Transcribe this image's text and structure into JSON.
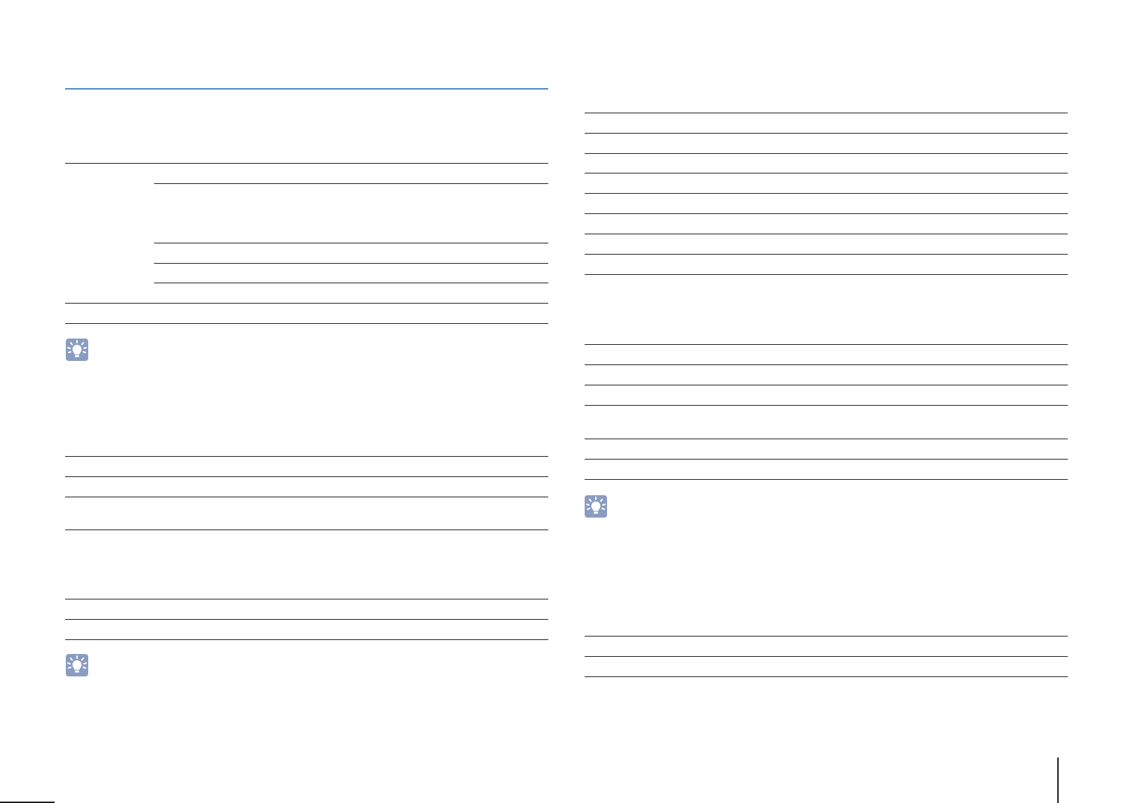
{
  "page": {
    "background": "#ffffff",
    "rule_color": "#1a1a1a",
    "accent": "#4a86c8",
    "tip_icon_color": "#8a9dc0"
  },
  "left_column": {
    "tip_icons": [
      "lightbulb-icon",
      "lightbulb-icon"
    ]
  },
  "right_column": {
    "tip_icons": [
      "lightbulb-icon"
    ]
  }
}
